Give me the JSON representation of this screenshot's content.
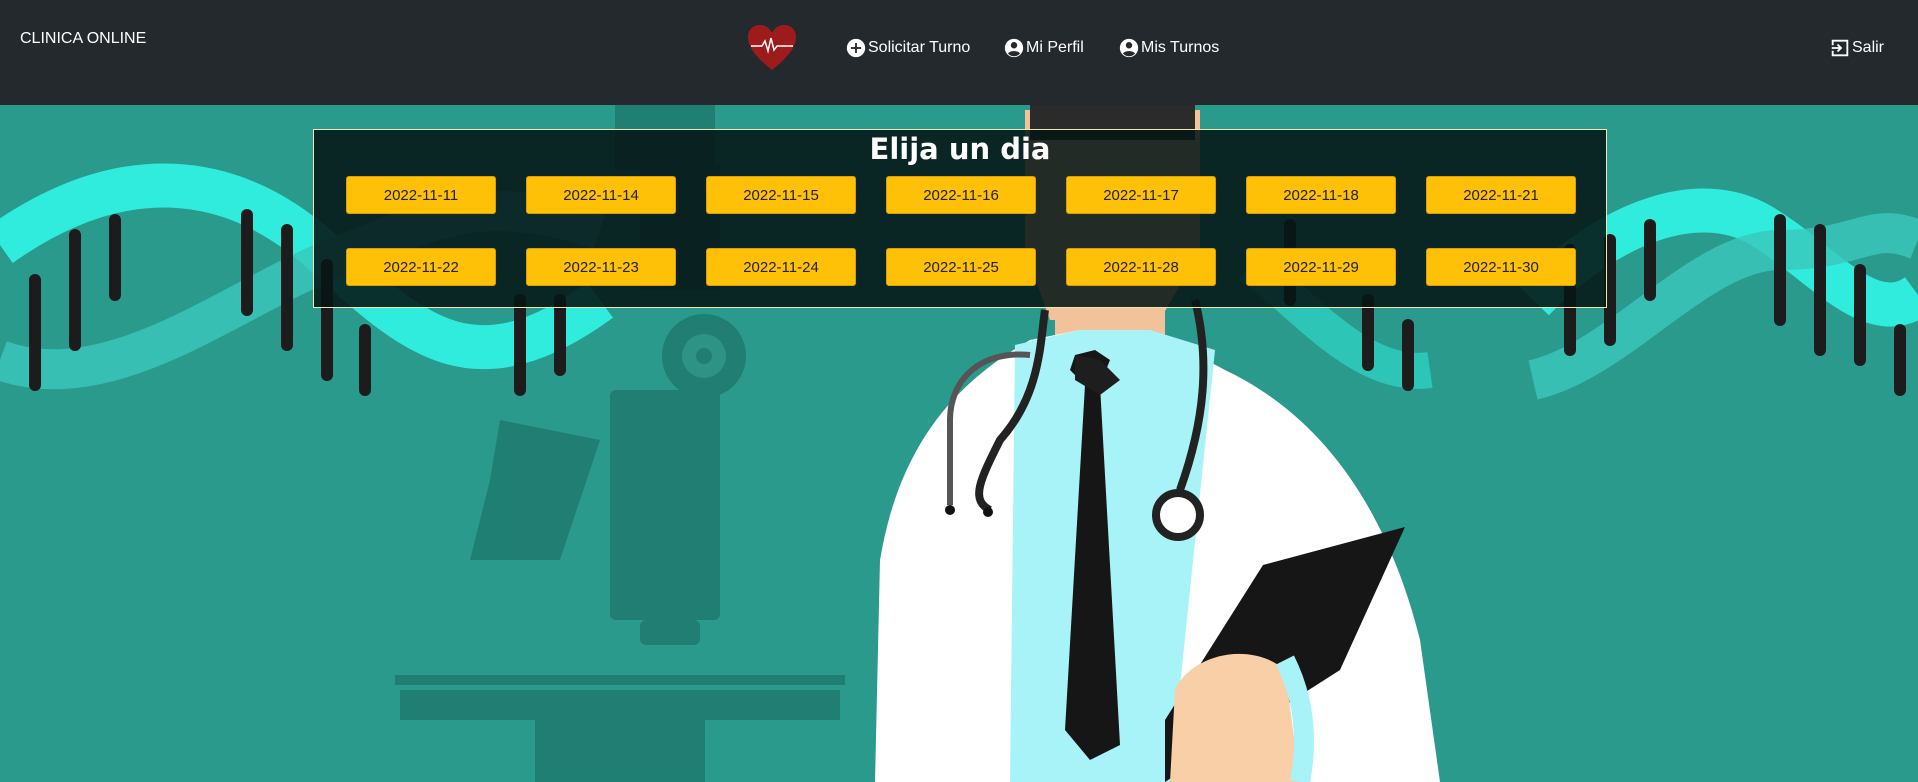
{
  "navbar": {
    "brand": "CLINICA ONLINE",
    "logo_icon": "heart-pulse-icon",
    "items": [
      {
        "label": "Solicitar Turno",
        "icon": "plus-circle-icon"
      },
      {
        "label": "Mi Perfil",
        "icon": "user-circle-icon"
      },
      {
        "label": "Mis Turnos",
        "icon": "user-circle-icon"
      }
    ],
    "logout": {
      "label": "Salir",
      "icon": "logout-icon"
    }
  },
  "panel": {
    "title": "Elija un dia",
    "days": [
      "2022-11-11",
      "2022-11-14",
      "2022-11-15",
      "2022-11-16",
      "2022-11-17",
      "2022-11-18",
      "2022-11-21",
      "2022-11-22",
      "2022-11-23",
      "2022-11-24",
      "2022-11-25",
      "2022-11-28",
      "2022-11-29",
      "2022-11-30"
    ]
  },
  "colors": {
    "navbar_bg": "#24292d",
    "page_bg": "#2a9a8d",
    "day_button": "#ffc107",
    "panel_border": "#f0e6b0"
  }
}
